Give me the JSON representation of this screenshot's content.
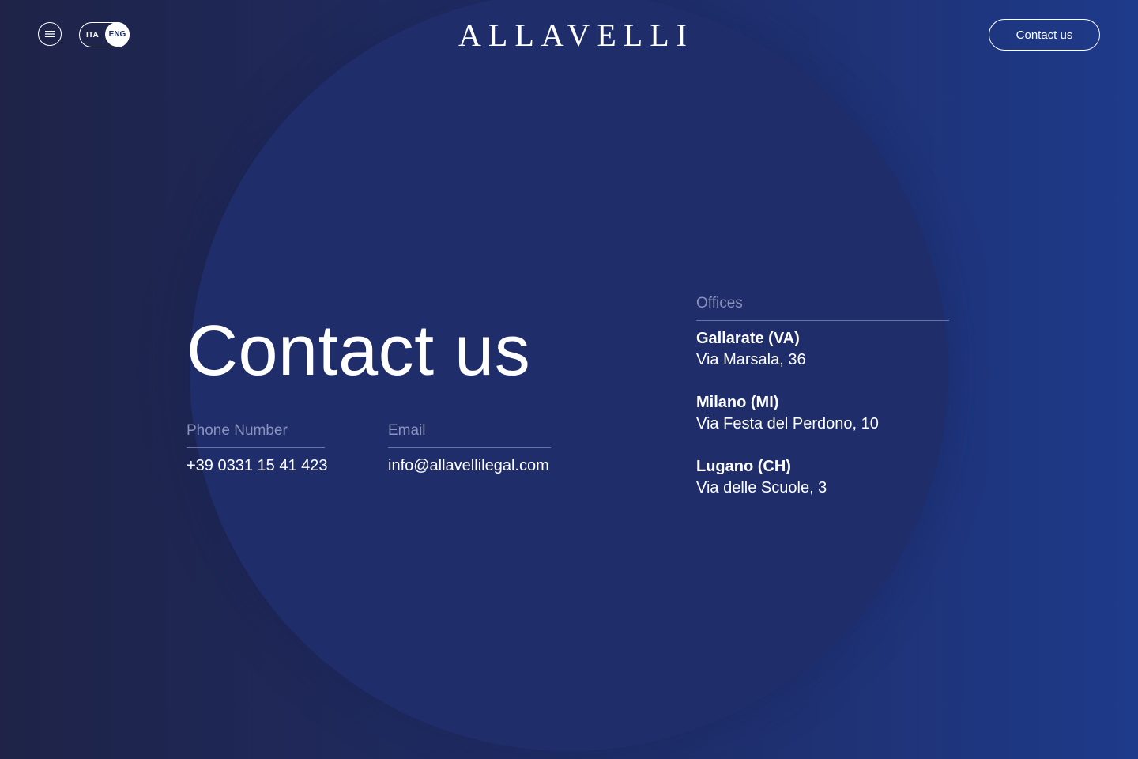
{
  "header": {
    "menu_icon": "hamburger-menu-icon",
    "language": {
      "options": [
        "ITA",
        "ENG"
      ],
      "selected": "ENG"
    },
    "logo_text": "ALLAVELLI",
    "cta_label": "Contact us"
  },
  "main": {
    "title": "Contact us",
    "phone": {
      "label": "Phone Number",
      "value": "+39 0331 15 41 423"
    },
    "email": {
      "label": "Email",
      "value": "info@allavellilegal.com"
    }
  },
  "offices": {
    "label": "Offices",
    "items": [
      {
        "city": "Gallarate (VA)",
        "address": "Via Marsala, 36"
      },
      {
        "city": "Milano (MI)",
        "address": "Via Festa del Perdono, 10"
      },
      {
        "city": "Lugano (CH)",
        "address": "Via delle Scuole, 3"
      }
    ]
  },
  "colors": {
    "background_left": "#1e2347",
    "background_right": "#1e3a8a",
    "circle": "#1f2d6a",
    "muted_label": "#8a93bd",
    "text": "#ffffff"
  }
}
